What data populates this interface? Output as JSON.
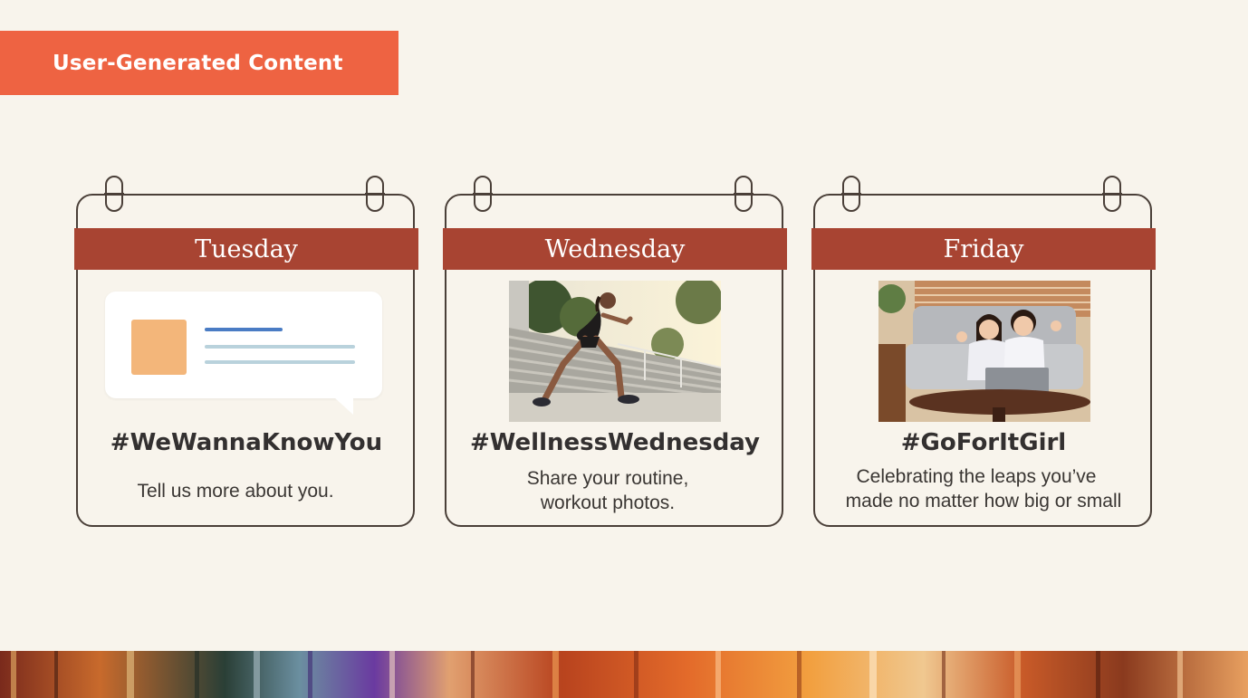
{
  "header": {
    "title": "User-Generated Content"
  },
  "cards": [
    {
      "day": "Tuesday",
      "hashtag": "#WeWannaKnowYou",
      "description_lines": [
        "Tell us more about you."
      ],
      "image_icon": "chat-bubble-icon"
    },
    {
      "day": "Wednesday",
      "hashtag": "#WellnessWednesday",
      "description_lines": [
        "Share your routine,",
        "workout photos."
      ],
      "image_icon": "workout-photo"
    },
    {
      "day": "Friday",
      "hashtag": "#GoForItGirl",
      "description_lines": [
        "Celebrating the leaps you’ve",
        "made no matter how big or small"
      ],
      "image_icon": "friends-laptop-photo"
    }
  ],
  "colors": {
    "background": "#f8f4ec",
    "banner": "#ee6342",
    "day_bar": "#a84432",
    "outline": "#4a3f38",
    "bubble_square": "#f3b67a",
    "bubble_line_primary": "#4a7cc4",
    "bubble_line_secondary": "#b9d2dc"
  }
}
